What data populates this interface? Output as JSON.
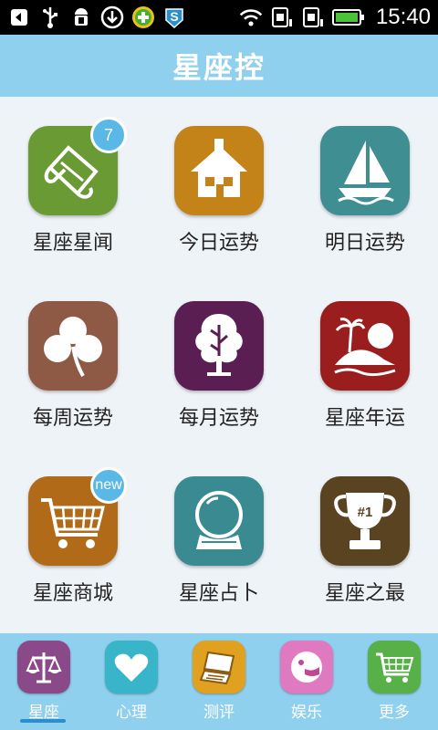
{
  "status_bar": {
    "time": "15:40",
    "icons": [
      "back-icon",
      "usb-icon",
      "android-debug-icon",
      "download-icon",
      "plus-app-icon",
      "s-app-icon",
      "wifi-icon",
      "sim1-icon",
      "sim2-icon",
      "battery-icon"
    ]
  },
  "header": {
    "title": "星座控"
  },
  "grid": {
    "items": [
      {
        "label": "星座星闻",
        "icon": "scroll-icon",
        "color": "#6a9a34",
        "badge": "7"
      },
      {
        "label": "今日运势",
        "icon": "house-icon",
        "color": "#c38318",
        "badge": ""
      },
      {
        "label": "明日运势",
        "icon": "sailboat-icon",
        "color": "#3f8e92",
        "badge": ""
      },
      {
        "label": "每周运势",
        "icon": "clover-icon",
        "color": "#8f5a45",
        "badge": ""
      },
      {
        "label": "每月运势",
        "icon": "tree-icon",
        "color": "#5a1e52",
        "badge": ""
      },
      {
        "label": "星座年运",
        "icon": "island-icon",
        "color": "#9a1e1e",
        "badge": ""
      },
      {
        "label": "星座商城",
        "icon": "cart-icon",
        "color": "#b06a18",
        "badge": "new"
      },
      {
        "label": "星座占卜",
        "icon": "crystal-ball-icon",
        "color": "#3a8a92",
        "badge": ""
      },
      {
        "label": "星座之最",
        "icon": "trophy-icon",
        "color": "#5a4320",
        "badge": ""
      }
    ]
  },
  "bottom_nav": {
    "items": [
      {
        "label": "星座",
        "icon": "scales-icon",
        "color": "#8a4a8a",
        "active": true
      },
      {
        "label": "心理",
        "icon": "heart-icon",
        "color": "#38b5c9",
        "active": false
      },
      {
        "label": "测评",
        "icon": "laptop-icon",
        "color": "#e0a020",
        "active": false
      },
      {
        "label": "娱乐",
        "icon": "smiley-icon",
        "color": "#e07ac0",
        "active": false
      },
      {
        "label": "更多",
        "icon": "cart-icon",
        "color": "#58b048",
        "active": false
      }
    ]
  },
  "badge7": "7",
  "badge_new": "new"
}
